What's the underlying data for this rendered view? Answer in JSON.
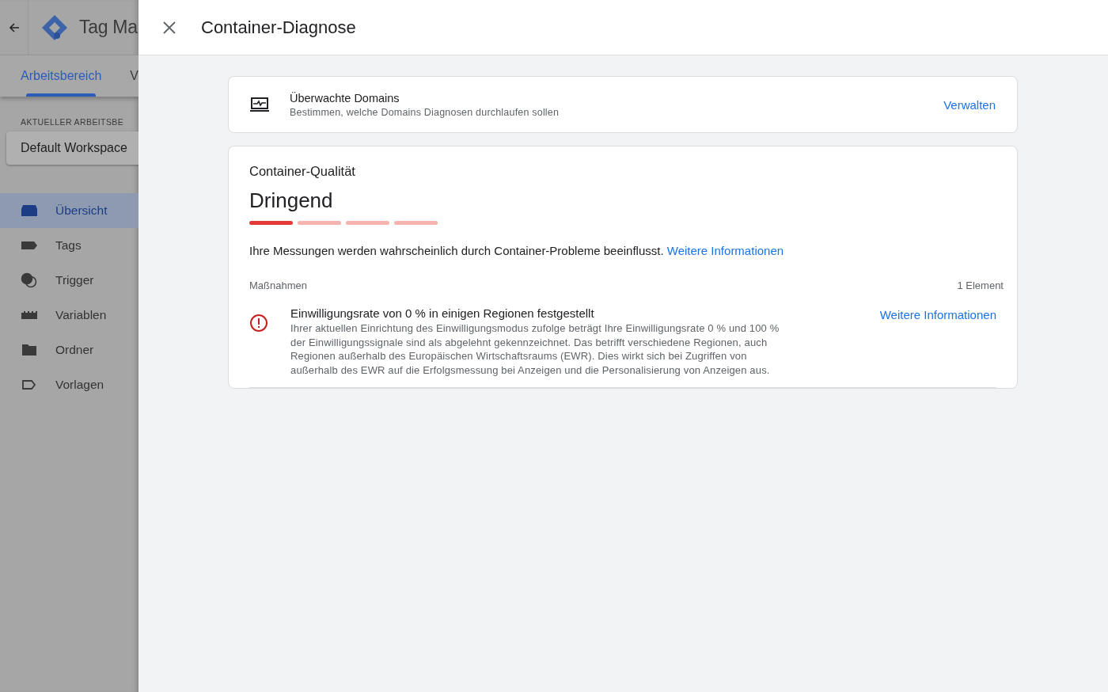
{
  "app": {
    "title": "Tag Ma",
    "tabs": [
      {
        "label": "Arbeitsbereich",
        "selected": true
      },
      {
        "label": "V",
        "selected": false
      }
    ],
    "workspace_label": "AKTUELLER ARBEITSBE",
    "workspace": "Default Workspace",
    "nav": [
      {
        "label": "Übersicht",
        "selected": true
      },
      {
        "label": "Tags",
        "selected": false
      },
      {
        "label": "Trigger",
        "selected": false
      },
      {
        "label": "Variablen",
        "selected": false
      },
      {
        "label": "Ordner",
        "selected": false
      },
      {
        "label": "Vorlagen",
        "selected": false
      }
    ]
  },
  "panel": {
    "title": "Container-Diagnose",
    "domains": {
      "title": "Überwachte Domains",
      "subtitle": "Bestimmen, welche Domains Diagnosen durchlaufen sollen",
      "action": "Verwalten"
    },
    "quality": {
      "heading": "Container-Qualität",
      "rating": "Dringend",
      "level": 0.25,
      "message": "Ihre Messungen werden wahrscheinlich durch Container-Probleme beeinflusst.",
      "link": "Weitere Informationen",
      "actions_label": "Maßnahmen",
      "count": "1 Element",
      "issues": [
        {
          "title": "Einwilligungsrate von 0 % in einigen Regionen festgestellt",
          "body": "Ihrer aktuellen Einrichtung des Einwilligungsmodus zufolge beträgt Ihre Einwilligungsrate 0 % und 100 % der Einwilligungssignale sind als abgelehnt gekennzeichnet. Das betrifft verschiedene Regionen, auch Regionen außerhalb des Europäischen Wirtschaftsraums (EWR). Dies wirkt sich bei Zugriffen von außerhalb des EWR auf die Erfolgsmessung bei Anzeigen und die Personalisierung von Anzeigen aus.",
          "link": "Weitere Informationen"
        }
      ]
    }
  }
}
